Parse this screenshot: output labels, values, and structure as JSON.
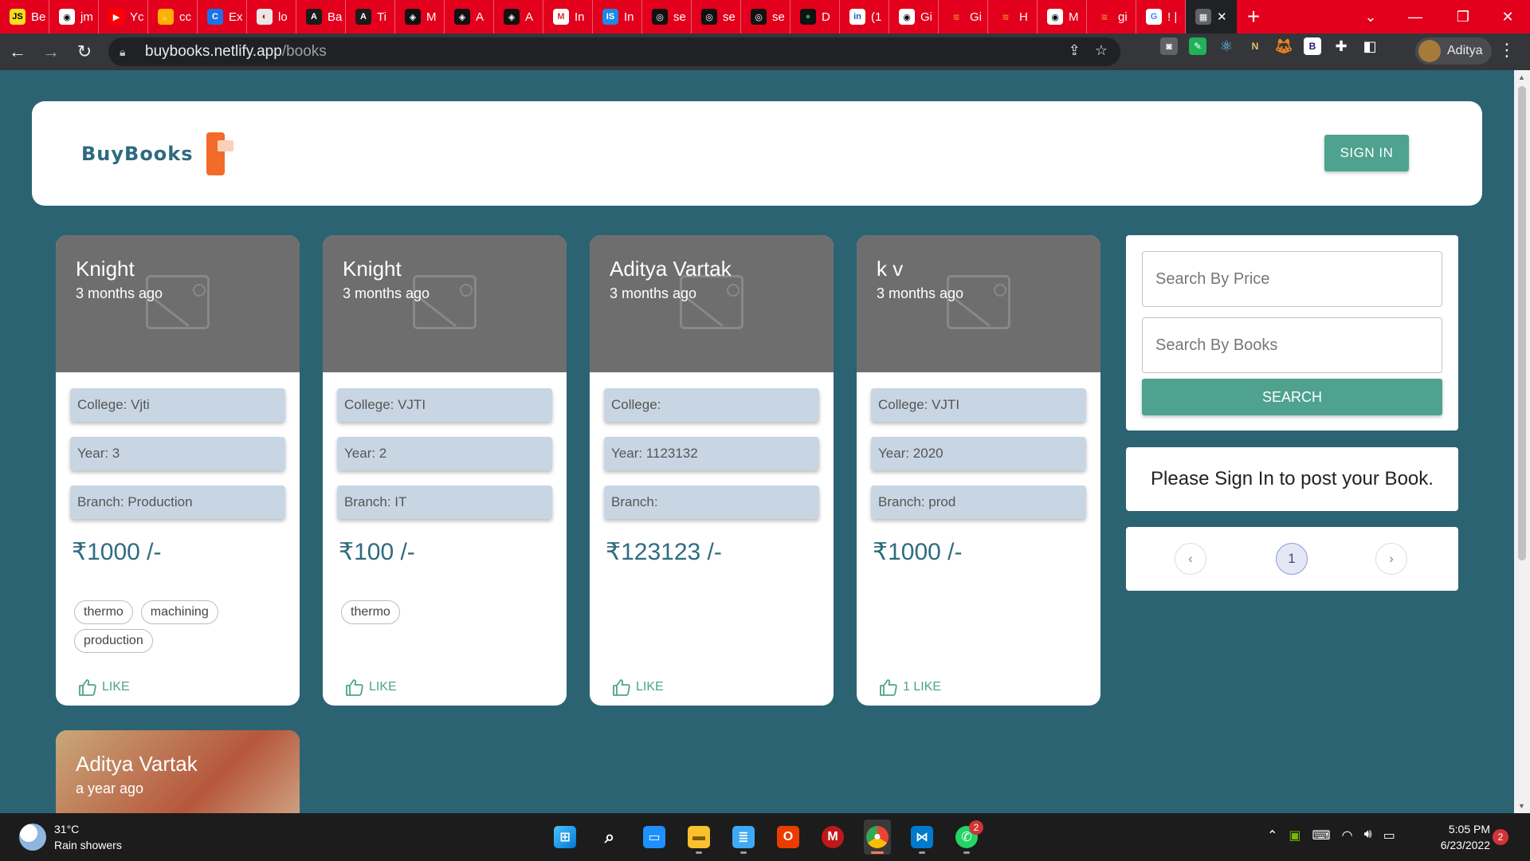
{
  "browser": {
    "tabs": [
      {
        "label": "Be",
        "icon": "js-icon",
        "color": "#f7df1e",
        "glyph": "JS",
        "glyph_color": "#000"
      },
      {
        "label": "jm",
        "icon": "github-icon",
        "color": "#fff",
        "glyph": "◉",
        "glyph_color": "#000"
      },
      {
        "label": "Yc",
        "icon": "youtube-icon",
        "color": "#ff0000",
        "glyph": "▶",
        "glyph_color": "#fff"
      },
      {
        "label": "cc",
        "icon": "fire-icon",
        "color": "#ffb000",
        "glyph": "✋",
        "glyph_color": "#fff"
      },
      {
        "label": "Ex",
        "icon": "c-logo-icon",
        "color": "#1a73e8",
        "glyph": "C",
        "glyph_color": "#fff"
      },
      {
        "label": "lo",
        "icon": "globe-icon",
        "color": "#e8e8e8",
        "glyph": "◐",
        "glyph_color": "#c00"
      },
      {
        "label": "Ba",
        "icon": "angular-icon",
        "color": "#1b1b1b",
        "glyph": "A",
        "glyph_color": "#fff"
      },
      {
        "label": "Ti",
        "icon": "angular-icon",
        "color": "#1b1b1b",
        "glyph": "A",
        "glyph_color": "#fff"
      },
      {
        "label": "M",
        "icon": "codepen-icon",
        "color": "#111",
        "glyph": "◈",
        "glyph_color": "#fff"
      },
      {
        "label": "A",
        "icon": "codepen-icon",
        "color": "#111",
        "glyph": "◈",
        "glyph_color": "#fff"
      },
      {
        "label": "A",
        "icon": "codepen-icon",
        "color": "#111",
        "glyph": "◈",
        "glyph_color": "#fff"
      },
      {
        "label": "In",
        "icon": "gmail-icon",
        "color": "#fff",
        "glyph": "M",
        "glyph_color": "#d93025"
      },
      {
        "label": "In",
        "icon": "is-icon",
        "color": "#1e88e5",
        "glyph": "IS",
        "glyph_color": "#fff"
      },
      {
        "label": "se",
        "icon": "chatgpt-icon",
        "color": "#111",
        "glyph": "◎",
        "glyph_color": "#fff"
      },
      {
        "label": "se",
        "icon": "chatgpt-icon",
        "color": "#111",
        "glyph": "◎",
        "glyph_color": "#fff"
      },
      {
        "label": "se",
        "icon": "chatgpt-icon",
        "color": "#111",
        "glyph": "◎",
        "glyph_color": "#fff"
      },
      {
        "label": "D",
        "icon": "mongodb-icon",
        "color": "#111",
        "glyph": "●",
        "glyph_color": "#13aa52"
      },
      {
        "label": "(1",
        "icon": "linkedin-icon",
        "color": "#fff",
        "glyph": "in",
        "glyph_color": "#0a66c2"
      },
      {
        "label": "Gi",
        "icon": "github-icon",
        "color": "#fff",
        "glyph": "◉",
        "glyph_color": "#000"
      },
      {
        "label": "Gi",
        "icon": "stackoverflow-icon",
        "color": "#e2001d",
        "glyph": "≋",
        "glyph_color": "#f48024"
      },
      {
        "label": "H",
        "icon": "stackoverflow-icon",
        "color": "#e2001d",
        "glyph": "≋",
        "glyph_color": "#f48024"
      },
      {
        "label": "M",
        "icon": "github-icon",
        "color": "#fff",
        "glyph": "◉",
        "glyph_color": "#000"
      },
      {
        "label": "gi",
        "icon": "stackoverflow-icon",
        "color": "#e2001d",
        "glyph": "≋",
        "glyph_color": "#f48024"
      },
      {
        "label": "! |",
        "icon": "google-icon",
        "color": "#fff",
        "glyph": "G",
        "glyph_color": "#4285f4"
      }
    ],
    "active_tab_close": "✕",
    "new_tab": "+",
    "address": {
      "domain": "buybooks.netlify.app",
      "path": "/books"
    },
    "profile_name": "Aditya"
  },
  "app": {
    "logo_text": "BuyBooks",
    "signin_label": "SIGN IN",
    "accent_color": "#4ea28f",
    "books": [
      {
        "title": "Knight",
        "time": "3 months ago",
        "college": "College: Vjti",
        "year": "Year: 3",
        "branch": "Branch: Production",
        "price": "₹1000 /-",
        "tags": [
          "thermo",
          "machining",
          "production"
        ],
        "like": "LIKE"
      },
      {
        "title": "Knight",
        "time": "3 months ago",
        "college": "College: VJTI",
        "year": "Year: 2",
        "branch": "Branch: IT",
        "price": "₹100 /-",
        "tags": [
          "thermo"
        ],
        "like": "LIKE"
      },
      {
        "title": "Aditya Vartak",
        "time": "3 months ago",
        "college": "College:",
        "year": "Year: 1123132",
        "branch": "Branch:",
        "price": "₹123123 /-",
        "tags": [],
        "like": "LIKE"
      },
      {
        "title": "k v",
        "time": "3 months ago",
        "college": "College: VJTI",
        "year": "Year: 2020",
        "branch": "Branch: prod",
        "price": "₹1000 /-",
        "tags": [],
        "like": "1 LIKE"
      }
    ],
    "partial_book": {
      "title": "Aditya Vartak",
      "time": "a year ago"
    },
    "search": {
      "price_placeholder": "Search By Price",
      "books_placeholder": "Search By Books",
      "button_label": "SEARCH"
    },
    "signin_message": "Please Sign In to post your Book.",
    "pagination": {
      "prev": "‹",
      "current": "1",
      "next": "›"
    }
  },
  "taskbar": {
    "temperature": "31°C",
    "weather": "Rain showers",
    "time": "5:05 PM",
    "date": "6/23/2022",
    "whatsapp_badge": "2",
    "notification_count": "2"
  }
}
